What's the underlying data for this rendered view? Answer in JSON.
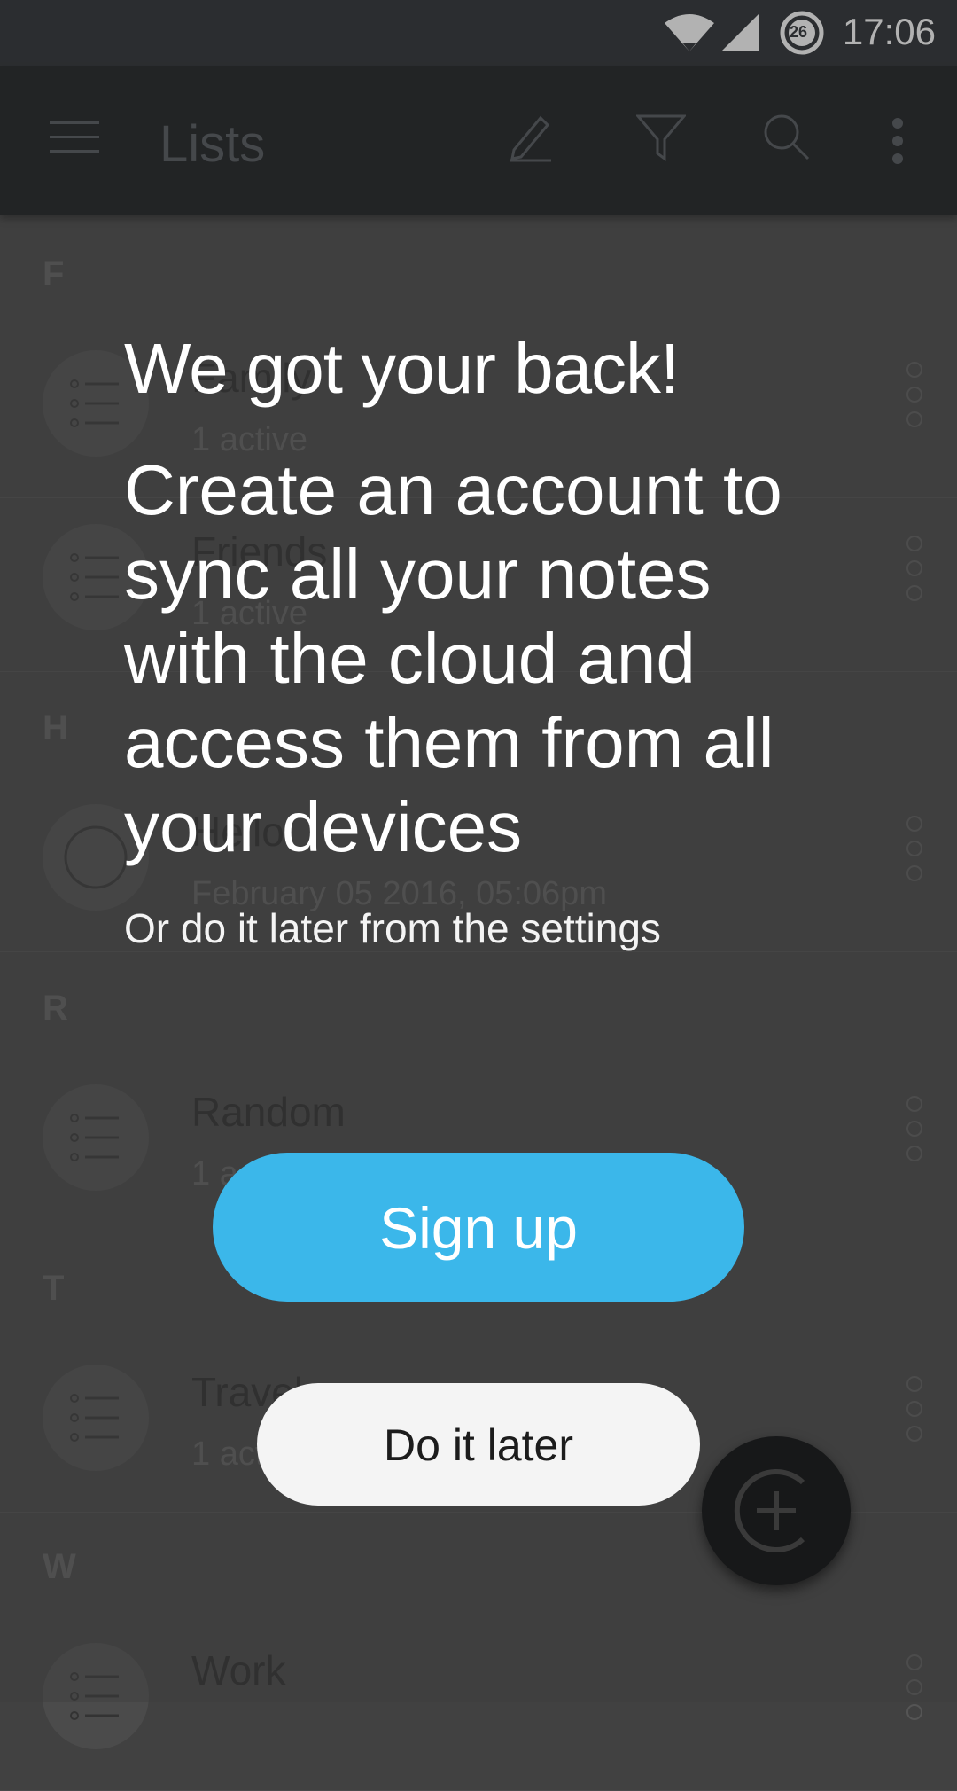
{
  "status_bar": {
    "time": "17:06",
    "notification_count": "26"
  },
  "app_bar": {
    "title": "Lists"
  },
  "sections": [
    {
      "letter": "F"
    },
    {
      "letter": "H"
    },
    {
      "letter": "R"
    },
    {
      "letter": "T"
    },
    {
      "letter": "W"
    }
  ],
  "items": [
    {
      "title": "Family",
      "subtitle": "1 active"
    },
    {
      "title": "Friends",
      "subtitle": "1 active"
    },
    {
      "title": "Hello",
      "subtitle": "February 05 2016, 05:06pm"
    },
    {
      "title": "Random",
      "subtitle": "1 active"
    },
    {
      "title": "Travel",
      "subtitle": "1 active"
    },
    {
      "title": "Work",
      "subtitle": ""
    }
  ],
  "dialog": {
    "heading": "We got your back!",
    "body": "Create an account to sync all your notes with the cloud and access them from all your devices",
    "hint": "Or do it later from the settings",
    "signup_label": "Sign up",
    "later_label": "Do it later"
  },
  "colors": {
    "accent": "#3bb7ea",
    "app_bar": "#15171a",
    "background": "#414141"
  },
  "icons": [
    "menu-icon",
    "edit-icon",
    "filter-icon",
    "search-icon",
    "more-vert-icon",
    "list-icon",
    "circle-icon",
    "add-icon",
    "wifi-icon",
    "signal-icon"
  ]
}
